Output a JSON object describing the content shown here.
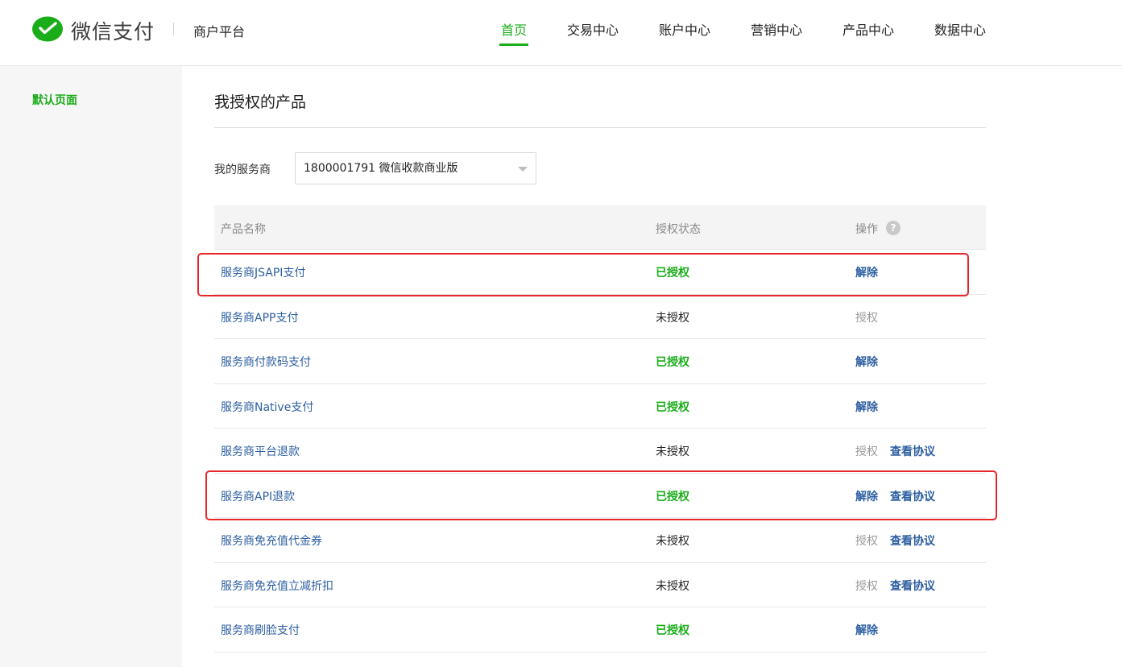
{
  "header": {
    "brand": "微信支付",
    "platform": "商户平台",
    "nav": [
      {
        "label": "首页",
        "active": true
      },
      {
        "label": "交易中心",
        "active": false
      },
      {
        "label": "账户中心",
        "active": false
      },
      {
        "label": "营销中心",
        "active": false
      },
      {
        "label": "产品中心",
        "active": false
      },
      {
        "label": "数据中心",
        "active": false
      }
    ]
  },
  "sidebar": {
    "items": [
      {
        "label": "默认页面",
        "active": true
      }
    ]
  },
  "main": {
    "title": "我授权的产品",
    "provider_label": "我的服务商",
    "provider_selected": "1800001791 微信收款商业版",
    "table": {
      "headers": [
        "产品名称",
        "授权状态",
        "操作"
      ],
      "help_icon_glyph": "?",
      "rows": [
        {
          "name": "服务商JSAPI支付",
          "status": "已授权",
          "authorized": true,
          "action": "解除",
          "agreement": ""
        },
        {
          "name": "服务商APP支付",
          "status": "未授权",
          "authorized": false,
          "action": "授权",
          "agreement": ""
        },
        {
          "name": "服务商付款码支付",
          "status": "已授权",
          "authorized": true,
          "action": "解除",
          "agreement": ""
        },
        {
          "name": "服务商Native支付",
          "status": "已授权",
          "authorized": true,
          "action": "解除",
          "agreement": ""
        },
        {
          "name": "服务商平台退款",
          "status": "未授权",
          "authorized": false,
          "action": "授权",
          "agreement": "查看协议"
        },
        {
          "name": "服务商API退款",
          "status": "已授权",
          "authorized": true,
          "action": "解除",
          "agreement": "查看协议"
        },
        {
          "name": "服务商免充值代金券",
          "status": "未授权",
          "authorized": false,
          "action": "授权",
          "agreement": "查看协议"
        },
        {
          "name": "服务商免充值立减折扣",
          "status": "未授权",
          "authorized": false,
          "action": "授权",
          "agreement": "查看协议"
        },
        {
          "name": "服务商刷脸支付",
          "status": "已授权",
          "authorized": true,
          "action": "解除",
          "agreement": ""
        }
      ]
    }
  },
  "colors": {
    "accent_green": "#1aad19",
    "link_blue": "#2c5ea1",
    "highlight_red": "#e8262a"
  },
  "icons": {
    "logo": "wechat-pay-logo-icon",
    "select_arrow": "chevron-down-icon",
    "help": "question-circle-icon"
  }
}
